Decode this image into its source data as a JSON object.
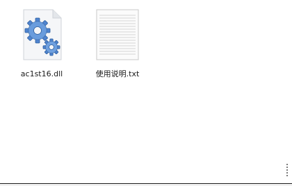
{
  "files": [
    {
      "name": "ac1st16.dll",
      "icon": "dll-gears-icon"
    },
    {
      "name": "使用说明.txt",
      "icon": "txt-document-icon"
    }
  ],
  "colors": {
    "background": "#ffffff",
    "label_text": "#1a1a1a",
    "gear_blue": "#5a8fd6",
    "page_border": "#c8c8c8"
  }
}
